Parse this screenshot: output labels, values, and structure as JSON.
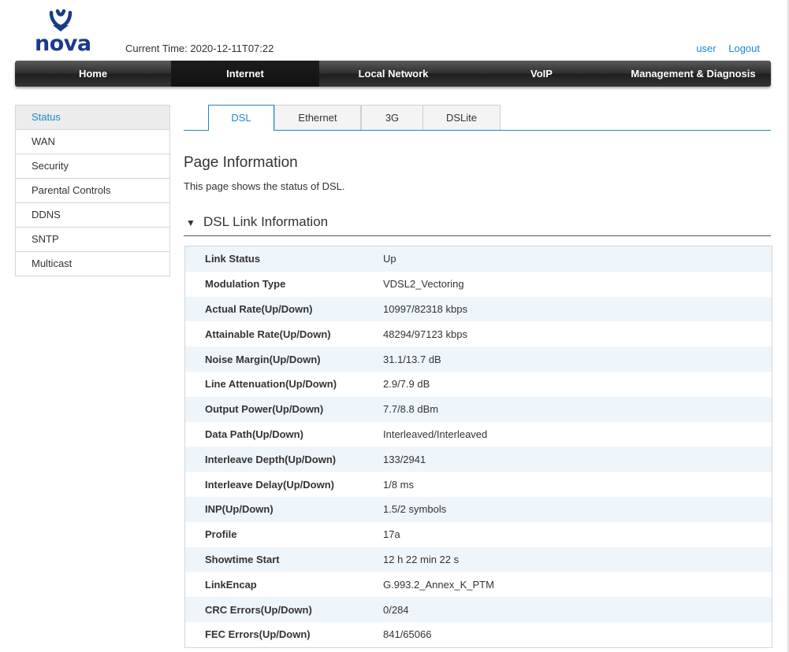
{
  "brand": {
    "logo_text": "nova"
  },
  "header": {
    "current_time": "Current Time: 2020-12-11T07:22",
    "user_link": "user",
    "logout_link": "Logout"
  },
  "nav": {
    "items": [
      "Home",
      "Internet",
      "Local Network",
      "VoIP",
      "Management & Diagnosis"
    ],
    "active": "Internet"
  },
  "sidebar": {
    "items": [
      "Status",
      "WAN",
      "Security",
      "Parental Controls",
      "DDNS",
      "SNTP",
      "Multicast"
    ],
    "active": "Status"
  },
  "tabs": {
    "items": [
      "DSL",
      "Ethernet",
      "3G",
      "DSLite"
    ],
    "active": "DSL"
  },
  "page": {
    "title": "Page Information",
    "description": "This page shows the status of DSL."
  },
  "section": {
    "title": "DSL Link Information",
    "arrow": "▼"
  },
  "dsl_info": {
    "rows": [
      {
        "label": "Link Status",
        "value": "Up"
      },
      {
        "label": "Modulation Type",
        "value": "VDSL2_Vectoring"
      },
      {
        "label": "Actual Rate(Up/Down)",
        "value": "10997/82318 kbps"
      },
      {
        "label": "Attainable Rate(Up/Down)",
        "value": "48294/97123 kbps"
      },
      {
        "label": "Noise Margin(Up/Down)",
        "value": "31.1/13.7 dB"
      },
      {
        "label": "Line Attenuation(Up/Down)",
        "value": "2.9/7.9 dB"
      },
      {
        "label": "Output Power(Up/Down)",
        "value": "7.7/8.8 dBm"
      },
      {
        "label": "Data Path(Up/Down)",
        "value": "Interleaved/Interleaved"
      },
      {
        "label": "Interleave Depth(Up/Down)",
        "value": "133/2941"
      },
      {
        "label": "Interleave Delay(Up/Down)",
        "value": "1/8 ms"
      },
      {
        "label": "INP(Up/Down)",
        "value": "1.5/2 symbols"
      },
      {
        "label": "Profile",
        "value": "17a"
      },
      {
        "label": "Showtime Start",
        "value": "12 h 22 min 22 s"
      },
      {
        "label": "LinkEncap",
        "value": "G.993.2_Annex_K_PTM"
      },
      {
        "label": "CRC Errors(Up/Down)",
        "value": "0/284"
      },
      {
        "label": "FEC Errors(Up/Down)",
        "value": "841/65066"
      }
    ]
  },
  "colors": {
    "accent": "#1a8ac9",
    "logo": "#1a3a8a",
    "row_alt": "#eef5fb",
    "nav_dark": "#1f1f1f"
  }
}
